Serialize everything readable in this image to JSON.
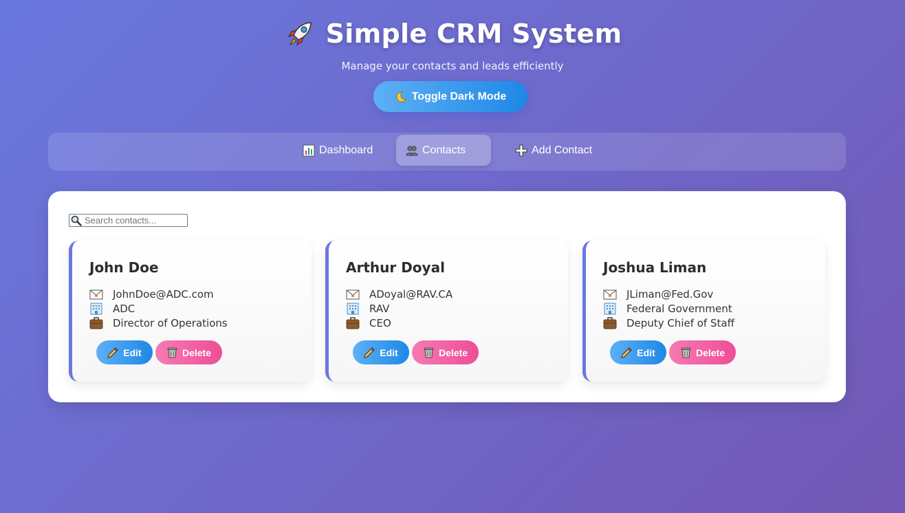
{
  "header": {
    "title": "Simple CRM System",
    "title_icon": "rocket-icon",
    "subtitle": "Manage your contacts and leads efficiently",
    "toggle_label": "Toggle Dark Mode",
    "toggle_icon": "moon-icon"
  },
  "nav": {
    "items": [
      {
        "label": "Dashboard",
        "icon": "bar-chart-icon",
        "active": false
      },
      {
        "label": "Contacts",
        "icon": "people-icon",
        "active": true
      },
      {
        "label": "Add Contact",
        "icon": "plus-icon",
        "active": false
      }
    ]
  },
  "search": {
    "placeholder": "Search contacts...",
    "value": ""
  },
  "contacts": [
    {
      "name": "John Doe",
      "email": "JohnDoe@ADC.com",
      "company": "ADC",
      "title": "Director of Operations"
    },
    {
      "name": "Arthur Doyal",
      "email": "ADoyal@RAV.CA",
      "company": "RAV",
      "title": "CEO"
    },
    {
      "name": "Joshua Liman",
      "email": "JLiman@Fed.Gov",
      "company": "Federal Government",
      "title": "Deputy Chief of Staff"
    }
  ],
  "actions": {
    "edit_label": "Edit",
    "delete_label": "Delete"
  },
  "colors": {
    "accent": "#6a78de",
    "edit": "#1e88e5",
    "delete": "#ee4e97",
    "background_start": "#6a78de",
    "background_end": "#7358b5"
  }
}
